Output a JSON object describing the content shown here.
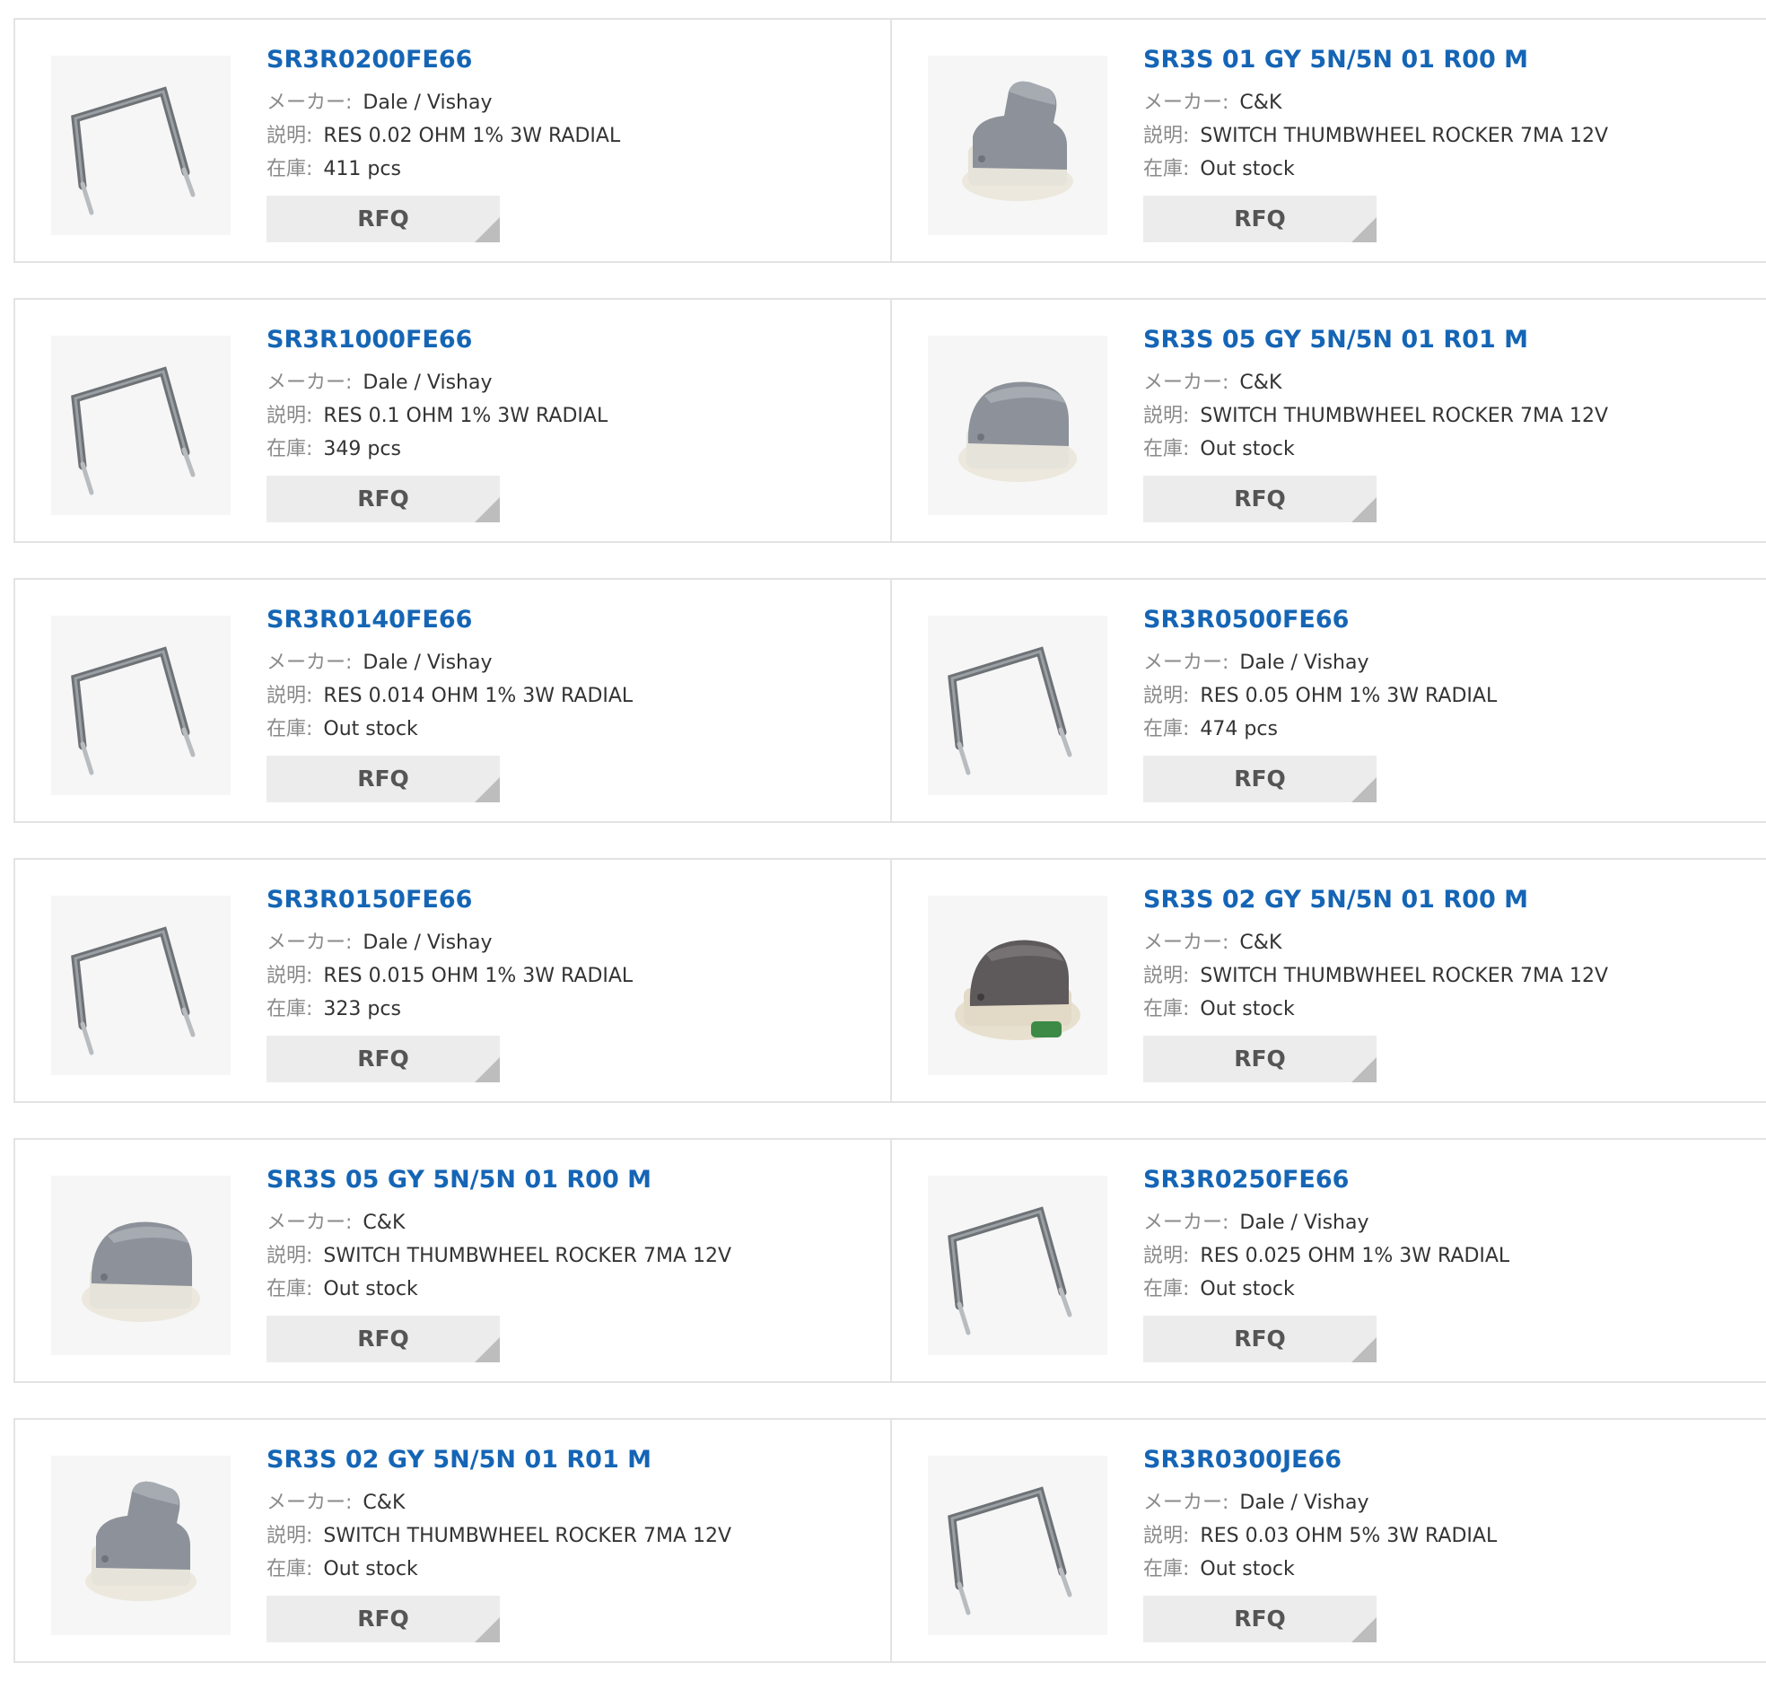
{
  "labels": {
    "maker": "メーカー:",
    "desc": "説明:",
    "stock": "在庫:",
    "rfq": "RFQ"
  },
  "products": [
    {
      "pn": "SR3R0200FE66",
      "maker": "Dale / Vishay",
      "desc": "RES 0.02 OHM 1% 3W RADIAL",
      "stock": "411 pcs",
      "image": "resistor-image"
    },
    {
      "pn": "SR3S 01 GY 5N/5N 01 R00 M",
      "maker": "C&K",
      "desc": "SWITCH THUMBWHEEL ROCKER 7MA 12V",
      "stock": "Out stock",
      "image": "switch-tall-image"
    },
    {
      "pn": "SR3R1000FE66",
      "maker": "Dale / Vishay",
      "desc": "RES 0.1 OHM 1% 3W RADIAL",
      "stock": "349 pcs",
      "image": "resistor-image"
    },
    {
      "pn": "SR3S 05 GY 5N/5N 01 R01 M",
      "maker": "C&K",
      "desc": "SWITCH THUMBWHEEL ROCKER 7MA 12V",
      "stock": "Out stock",
      "image": "switch-flat-image"
    },
    {
      "pn": "SR3R0140FE66",
      "maker": "Dale / Vishay",
      "desc": "RES 0.014 OHM 1% 3W RADIAL",
      "stock": "Out stock",
      "image": "resistor-image"
    },
    {
      "pn": "SR3R0500FE66",
      "maker": "Dale / Vishay",
      "desc": "RES 0.05 OHM 1% 3W RADIAL",
      "stock": "474 pcs",
      "image": "resistor-image"
    },
    {
      "pn": "SR3R0150FE66",
      "maker": "Dale / Vishay",
      "desc": "RES 0.015 OHM 1% 3W RADIAL",
      "stock": "323 pcs",
      "image": "resistor-image"
    },
    {
      "pn": "SR3S 02 GY 5N/5N 01 R00 M",
      "maker": "C&K",
      "desc": "SWITCH THUMBWHEEL ROCKER 7MA 12V",
      "stock": "Out stock",
      "image": "switch-dark-image"
    },
    {
      "pn": "SR3S 05 GY 5N/5N 01 R00 M",
      "maker": "C&K",
      "desc": "SWITCH THUMBWHEEL ROCKER 7MA 12V",
      "stock": "Out stock",
      "image": "switch-flat-image"
    },
    {
      "pn": "SR3R0250FE66",
      "maker": "Dale / Vishay",
      "desc": "RES 0.025 OHM 1% 3W RADIAL",
      "stock": "Out stock",
      "image": "resistor-image"
    },
    {
      "pn": "SR3S 02 GY 5N/5N 01 R01 M",
      "maker": "C&K",
      "desc": "SWITCH THUMBWHEEL ROCKER 7MA 12V",
      "stock": "Out stock",
      "image": "switch-tall-image"
    },
    {
      "pn": "SR3R0300JE66",
      "maker": "Dale / Vishay",
      "desc": "RES 0.03 OHM 5% 3W RADIAL",
      "stock": "Out stock",
      "image": "resistor-image"
    }
  ],
  "colors": {
    "link": "#1565b5",
    "button_bg": "#ececec",
    "border": "#e3e3e3"
  }
}
